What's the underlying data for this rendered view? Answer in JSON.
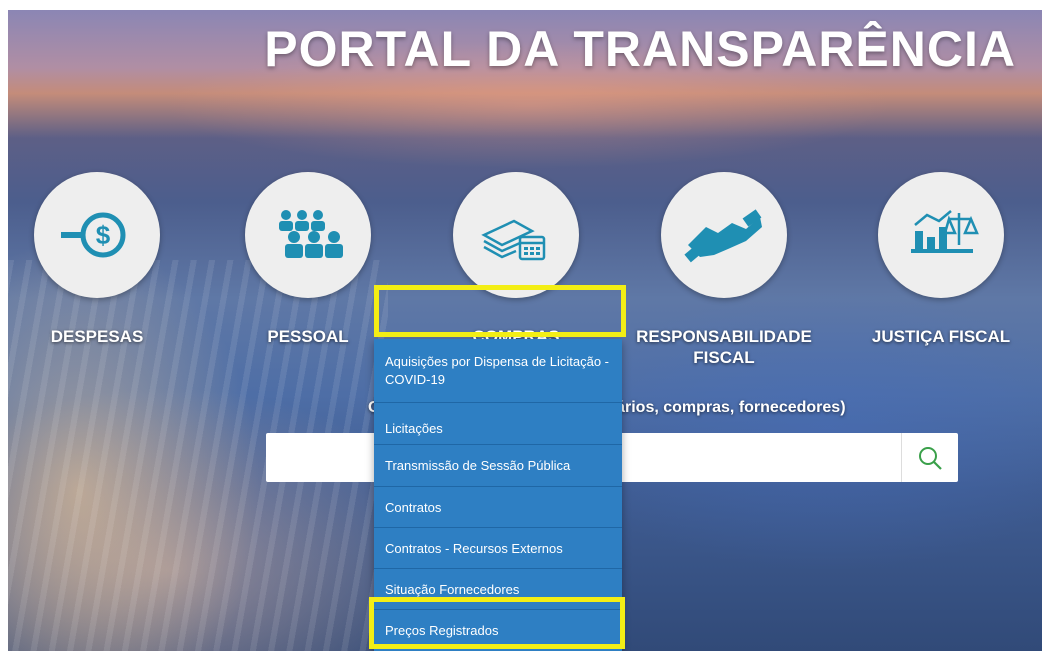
{
  "header": {
    "title": "PORTAL DA TRANSPARÊNCIA"
  },
  "categories": [
    {
      "label": "DESPESAS",
      "icon": "dollar-icon"
    },
    {
      "label": "PESSOAL",
      "icon": "people-icon"
    },
    {
      "label": "COMPRAS",
      "icon": "money-calendar-icon"
    },
    {
      "label": "RESPONSABILIDADE FISCAL",
      "icon": "handshake-icon"
    },
    {
      "label": "JUSTIÇA FISCAL",
      "icon": "chart-scale-icon"
    }
  ],
  "search": {
    "hint": "O que deseja pesquisar? (ex. salários, compras, fornecedores)",
    "placeholder": ""
  },
  "compras_menu": {
    "items": [
      "Aquisições por Dispensa de Licitação - COVID-19",
      "Licitações",
      "Transmissão de Sessão Pública",
      "Contratos",
      "Contratos - Recursos Externos",
      "Situação Fornecedores",
      "Preços Registrados"
    ]
  },
  "colors": {
    "accent": "#2e7fc3",
    "icon_teal": "#1f8fb3",
    "highlight": "#f3ee15",
    "search_icon": "#3aa04a"
  }
}
